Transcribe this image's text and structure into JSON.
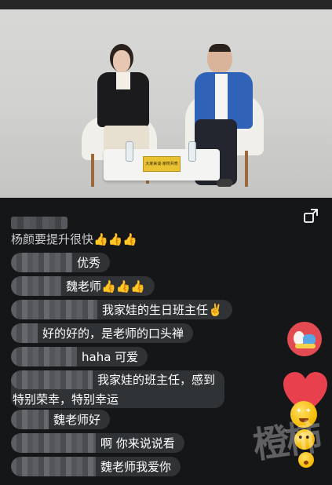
{
  "video": {
    "table_sign_text": "大家来谈·家校共育"
  },
  "comments": [
    {
      "text": "杨颜要提升很快👍👍👍"
    },
    {
      "text": "优秀"
    },
    {
      "text": "魏老师👍👍👍"
    },
    {
      "text": "我家娃的生日班主任✌️"
    },
    {
      "text": "好的好的，是老师的口头禅"
    },
    {
      "text": "haha 可爱"
    },
    {
      "text": "我家娃的班主任，感到"
    },
    {
      "text": "特别荣幸，特别幸运"
    },
    {
      "text": "魏老师好"
    },
    {
      "text": "啊 你来说说看"
    },
    {
      "text": "魏老师我爱你"
    }
  ],
  "watermark": "橙柿",
  "colors": {
    "background": "#151618",
    "comment_bubble": "#3c3e42",
    "heart": "#e8414d",
    "emoji": "#f5b800"
  },
  "icons": [
    "fullscreen-icon",
    "gift-avatar-icon",
    "heart-icon",
    "emoji-icon"
  ]
}
